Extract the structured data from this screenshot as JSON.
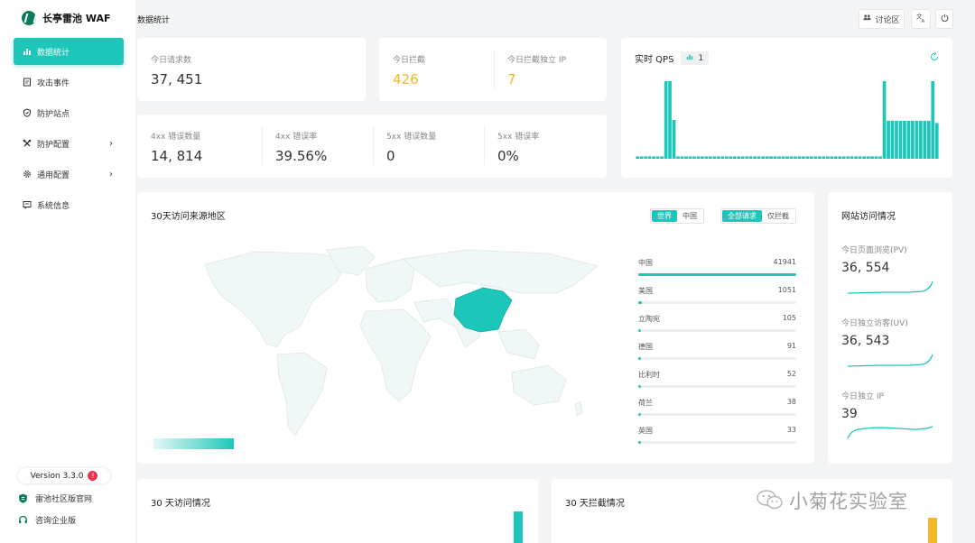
{
  "brand": {
    "name": "长亭雷池 WAF"
  },
  "header": {
    "title": "数据统计",
    "discuss_label": "讨论区"
  },
  "nav": {
    "items": [
      {
        "label": "数据统计",
        "icon": "bar-chart-icon",
        "active": true
      },
      {
        "label": "攻击事件",
        "icon": "document-icon"
      },
      {
        "label": "防护站点",
        "icon": "shield-icon"
      },
      {
        "label": "防护配置",
        "icon": "tools-icon",
        "has_submenu": true
      },
      {
        "label": "通用配置",
        "icon": "gear-icon",
        "has_submenu": true
      },
      {
        "label": "系统信息",
        "icon": "message-icon"
      }
    ]
  },
  "footer": {
    "version": "Version 3.3.0",
    "version_badge": "!",
    "community_link": "雷池社区版官网",
    "enterprise_link": "咨询企业版"
  },
  "stats": {
    "requests_label": "今日请求数",
    "requests_value": "37, 451",
    "blocked_label": "今日拦截",
    "blocked_value": "426",
    "blocked_ip_label": "今日拦截独立 IP",
    "blocked_ip_value": "7",
    "err4xx_count_label": "4xx 错误数量",
    "err4xx_count_value": "14, 814",
    "err4xx_rate_label": "4xx 错误率",
    "err4xx_rate_value": "39.56%",
    "err5xx_count_label": "5xx 错误数量",
    "err5xx_count_value": "0",
    "err5xx_rate_label": "5xx 错误率",
    "err5xx_rate_value": "0%"
  },
  "qps": {
    "title": "实时 QPS",
    "badge_value": "1"
  },
  "map": {
    "title": "30天访问来源地区",
    "scope_options": [
      "世界",
      "中国"
    ],
    "filter_options": [
      "全部请求",
      "仅拦截"
    ],
    "ranking": [
      {
        "name": "中国",
        "value": 41941
      },
      {
        "name": "美国",
        "value": 1051
      },
      {
        "name": "立陶宛",
        "value": 105
      },
      {
        "name": "德国",
        "value": 91
      },
      {
        "name": "比利时",
        "value": 52
      },
      {
        "name": "荷兰",
        "value": 38
      },
      {
        "name": "英国",
        "value": 33
      }
    ]
  },
  "site": {
    "title": "网站访问情况",
    "pv_label": "今日页面浏览(PV)",
    "pv_value": "36, 554",
    "uv_label": "今日独立访客(UV)",
    "uv_value": "36, 543",
    "ip_label": "今日独立 IP",
    "ip_value": "39"
  },
  "bottom": {
    "visits_title": "30 天访问情况",
    "blocks_title": "30 天拦截情况"
  },
  "watermark": "小菊花实验室",
  "colors": {
    "accent": "#1cc7b9",
    "yellow": "#f5b72a",
    "map_base": "#f0f7f7",
    "china": "#1cc7b9"
  }
}
